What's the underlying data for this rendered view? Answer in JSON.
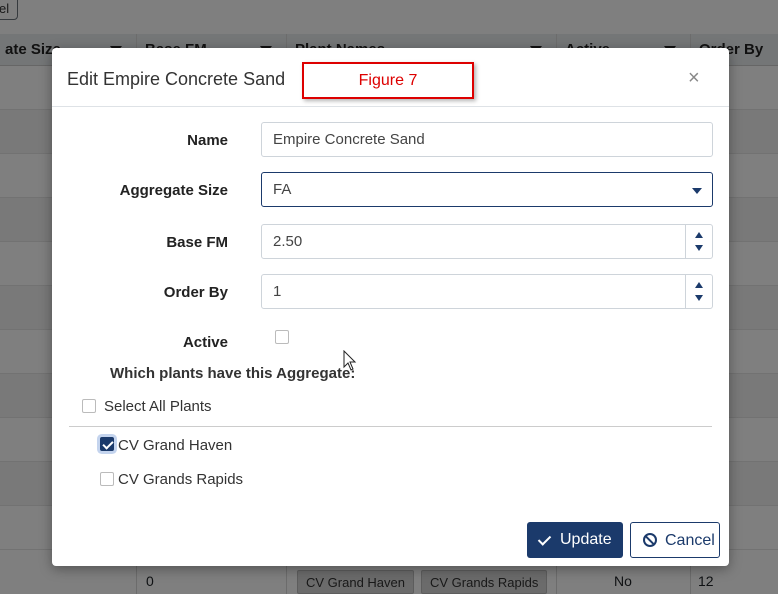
{
  "background": {
    "top_button_label": "el",
    "columns": [
      {
        "label": "ate Size"
      },
      {
        "label": "Base FM"
      },
      {
        "label": "Plant Names"
      },
      {
        "label": "Active"
      },
      {
        "label": "Order By"
      }
    ],
    "last_row": {
      "size": "0",
      "plants": [
        "CV Grand Haven",
        "CV Grands Rapids"
      ],
      "active": "No",
      "order_by": "12"
    }
  },
  "modal": {
    "title": "Edit Empire Concrete Sand",
    "annotation": "Figure 7",
    "close_glyph": "×",
    "fields": {
      "name": {
        "label": "Name",
        "value": "Empire Concrete Sand"
      },
      "aggregate_size": {
        "label": "Aggregate Size",
        "value": "FA"
      },
      "base_fm": {
        "label": "Base FM",
        "value": "2.50"
      },
      "order_by": {
        "label": "Order By",
        "value": "1"
      },
      "active": {
        "label": "Active",
        "checked": false
      }
    },
    "plants_prompt": "Which plants have this Aggregate:",
    "select_all_label": "Select All Plants",
    "plants": [
      {
        "label": "CV Grand Haven",
        "checked": true
      },
      {
        "label": "CV Grands Rapids",
        "checked": false
      }
    ],
    "update_label": "Update",
    "cancel_label": "Cancel"
  },
  "colors": {
    "primary": "#1b3a6b",
    "annotation_red": "#dd0000"
  }
}
